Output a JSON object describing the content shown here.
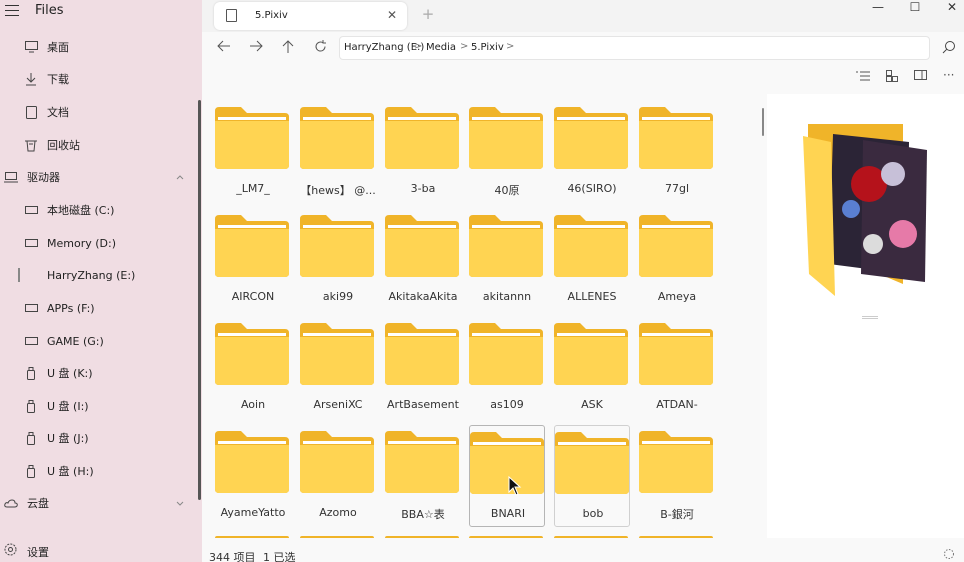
{
  "app": {
    "title": "Files"
  },
  "sidebar": {
    "items": [
      {
        "label": "桌面",
        "icon": "desktop-icon"
      },
      {
        "label": "下载",
        "icon": "download-icon"
      },
      {
        "label": "文档",
        "icon": "document-icon"
      },
      {
        "label": "回收站",
        "icon": "recycle-bin-icon"
      }
    ],
    "drives_header": "驱动器",
    "drives": [
      {
        "label": "本地磁盘 (C:)"
      },
      {
        "label": "Memory (D:)"
      },
      {
        "label": "HarryZhang (E:)"
      },
      {
        "label": "APPs (F:)"
      },
      {
        "label": "GAME (G:)"
      },
      {
        "label": "U 盘 (K:)"
      },
      {
        "label": "U 盘 (I:)"
      },
      {
        "label": "U 盘 (J:)"
      },
      {
        "label": "U 盘 (H:)"
      }
    ],
    "cloud_header": "云盘",
    "settings_label": "设置"
  },
  "tab": {
    "label": "5.Pixiv",
    "close": "✕",
    "new": "+"
  },
  "window": {
    "minimize": "—",
    "maximize": "☐",
    "close": "✕"
  },
  "address": {
    "crumbs": [
      "HarryZhang (E:)",
      "Media",
      "5.Pixiv"
    ],
    "separator": ">"
  },
  "folders": [
    "_LM7_",
    "【hews】 @...",
    "3-ba",
    "40原",
    "46(SIRO)",
    "77gl",
    "AIRCON",
    "aki99",
    "AkitakaAkita",
    "akitannn",
    "ALLENES",
    "Ameya",
    "Aoin",
    "ArseniXC",
    "ArtBasement",
    "as109",
    "ASK",
    "ATDAN-",
    "AyameYatto",
    "Azomo",
    "BBA☆表",
    "BNARI",
    "bob",
    "B-銀河"
  ],
  "colors": {
    "folder_back": "#f0b429",
    "folder_front": "#ffd452",
    "sidebar_bg": "#f0dde3"
  },
  "status": {
    "count": "344 项目",
    "selected": "1 已选"
  }
}
